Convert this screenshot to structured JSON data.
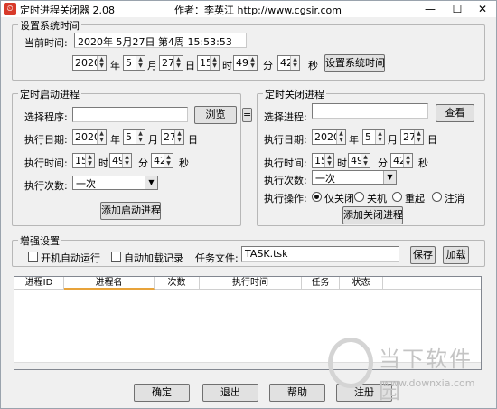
{
  "window": {
    "title": "定时进程关闭器 2.08",
    "author_line": "作者：李英江   http://www.cgsir.com",
    "min": "—",
    "max": "☐",
    "close": "✕"
  },
  "system_time": {
    "group_label": "设置系统时间",
    "current_label": "当前时间:",
    "current_value": "2020年 5月27日 第4周 15:53:53",
    "year": "2020",
    "year_unit": "年",
    "month": "5",
    "month_unit": "月",
    "day": "27",
    "day_unit": "日",
    "hour": "15",
    "hour_unit": "时",
    "minute": "49",
    "minute_unit": "分",
    "second": "42",
    "second_unit": "秒",
    "set_button": "设置系统时间"
  },
  "start_process": {
    "group_label": "定时启动进程",
    "choose_label": "选择程序:",
    "browse_button": "浏览",
    "eq_button": "=",
    "date_label": "执行日期:",
    "year": "2020",
    "year_unit": "年",
    "month": "5",
    "month_unit": "月",
    "day": "27",
    "day_unit": "日",
    "time_label": "执行时间:",
    "hour": "15",
    "hour_unit": "时",
    "minute": "49",
    "minute_unit": "分",
    "second": "42",
    "second_unit": "秒",
    "count_label": "执行次数:",
    "count_value": "一次",
    "add_button": "添加启动进程"
  },
  "close_process": {
    "group_label": "定时关闭进程",
    "choose_label": "选择进程:",
    "view_button": "查看",
    "date_label": "执行日期:",
    "year": "2020",
    "year_unit": "年",
    "month": "5",
    "month_unit": "月",
    "day": "27",
    "day_unit": "日",
    "time_label": "执行时间:",
    "hour": "15",
    "hour_unit": "时",
    "minute": "49",
    "minute_unit": "分",
    "second": "42",
    "second_unit": "秒",
    "count_label": "执行次数:",
    "count_value": "一次",
    "op_label": "执行操作:",
    "op_close_only": "仅关闭",
    "op_shutdown": "关机",
    "op_restart": "重起",
    "op_logoff": "注消",
    "add_button": "添加关闭进程"
  },
  "enhanced": {
    "group_label": "增强设置",
    "autostart": "开机自动运行",
    "autoload": "自动加载记录",
    "task_file_label": "任务文件:",
    "task_file_value": "TASK.tsk",
    "save_button": "保存",
    "load_button": "加载"
  },
  "grid": {
    "columns": [
      "进程ID",
      "进程名",
      "次数",
      "执行时间",
      "任务",
      "状态"
    ]
  },
  "bottom": {
    "ok": "确定",
    "exit": "退出",
    "help": "帮助",
    "register": "注册"
  },
  "watermark": {
    "title": "当下软件园",
    "url": "www.downxia.com"
  }
}
